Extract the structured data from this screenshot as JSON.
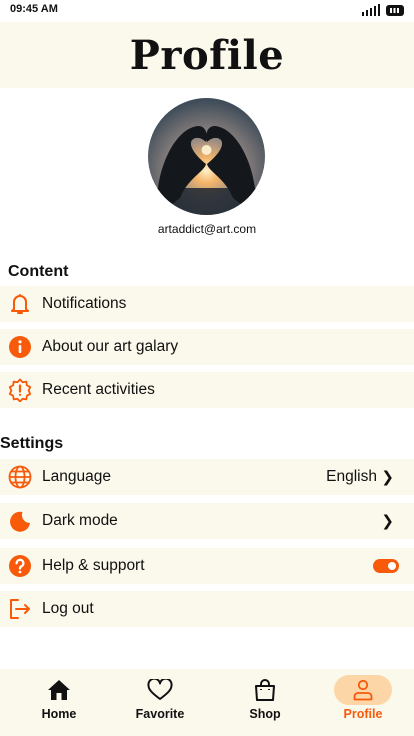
{
  "status_bar": {
    "time": "09:45 AM"
  },
  "header": {
    "title": "Profile"
  },
  "profile": {
    "email": "artaddict@art.com"
  },
  "content_section": {
    "title": "Content",
    "items": [
      {
        "label": "Notifications",
        "icon": "bell-icon"
      },
      {
        "label": "About our art galary",
        "icon": "info-icon"
      },
      {
        "label": "Recent activities",
        "icon": "alert-badge-icon"
      }
    ]
  },
  "settings_section": {
    "title": "Settings",
    "items": [
      {
        "label": "Language",
        "value": "English",
        "icon": "globe-icon"
      },
      {
        "label": "Dark mode",
        "icon": "moon-icon"
      },
      {
        "label": "Help & support",
        "icon": "help-icon",
        "toggle_on": true
      },
      {
        "label": "Log out",
        "icon": "logout-icon"
      }
    ]
  },
  "tab_bar": {
    "tabs": [
      {
        "label": "Home",
        "icon": "home-icon"
      },
      {
        "label": "Favorite",
        "icon": "heart-icon"
      },
      {
        "label": "Shop",
        "icon": "shopping-bag-icon"
      },
      {
        "label": "Profile",
        "icon": "user-icon",
        "active": true
      }
    ]
  },
  "colors": {
    "accent": "#f85a0a",
    "row_background": "#fbf8ec",
    "active_tab_pill": "#fdd6a8"
  }
}
